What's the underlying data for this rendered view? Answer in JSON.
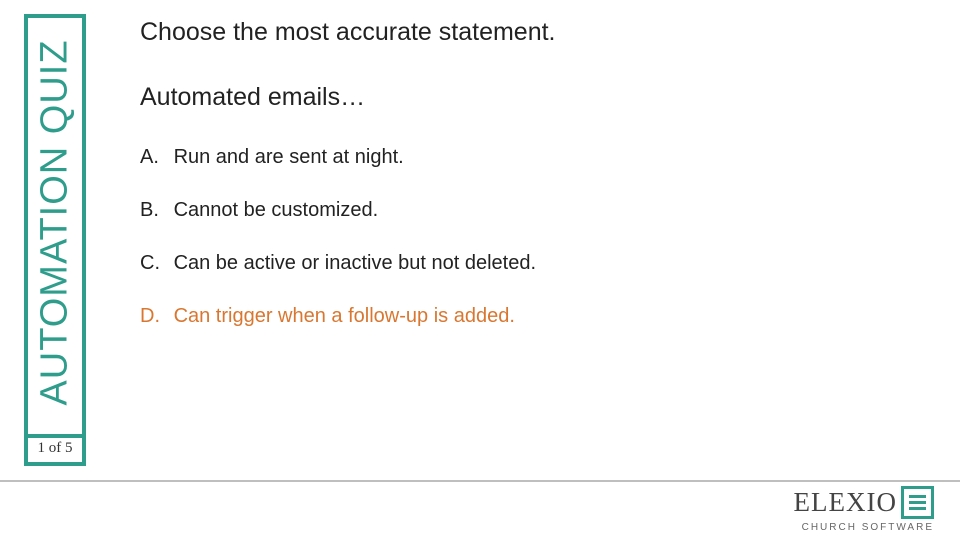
{
  "colors": {
    "accent": "#2e9d8c",
    "highlight": "#d97730"
  },
  "sidebar": {
    "title": "AUTOMATION QUIZ"
  },
  "progress": {
    "label": "1 of 5"
  },
  "question": {
    "instruction": "Choose the most accurate statement.",
    "stem": "Automated emails…",
    "options": [
      {
        "letter": "A.",
        "text": "Run and are sent at night."
      },
      {
        "letter": "B.",
        "text": "Cannot be customized."
      },
      {
        "letter": "C.",
        "text": "Can be active or inactive but not deleted."
      },
      {
        "letter": "D.",
        "text": "Can trigger when a follow-up is added."
      }
    ],
    "highlighted_index": 3
  },
  "brand": {
    "name": "ELEXIO",
    "tagline": "CHURCH SOFTWARE",
    "mark_icon": "bars-icon"
  }
}
